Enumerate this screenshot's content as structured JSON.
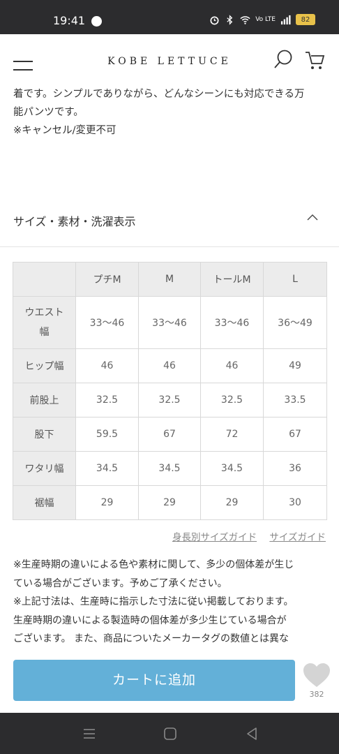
{
  "status_bar": {
    "time": "19:41",
    "battery": "82",
    "volte": "Vo LTE"
  },
  "header": {
    "brand": "KOBE LETTUCE"
  },
  "description": {
    "lines": [
      "着です。シンプルでありながら、どんなシーンにも対応できる万",
      "能パンツです。",
      "※キャンセル/変更不可"
    ]
  },
  "size_section": {
    "title": "サイズ・素材・洗濯表示"
  },
  "size_table": {
    "columns": [
      "",
      "プチM",
      "M",
      "トールM",
      "L"
    ],
    "rows": [
      {
        "label_line1": "ウエスト",
        "label_line2": "幅",
        "values": [
          "33〜46",
          "33〜46",
          "33〜46",
          "36〜49"
        ]
      },
      {
        "label": "ヒップ幅",
        "values": [
          "46",
          "46",
          "46",
          "49"
        ]
      },
      {
        "label": "前股上",
        "values": [
          "32.5",
          "32.5",
          "32.5",
          "33.5"
        ]
      },
      {
        "label": "股下",
        "values": [
          "59.5",
          "67",
          "72",
          "67"
        ]
      },
      {
        "label": "ワタリ幅",
        "values": [
          "34.5",
          "34.5",
          "34.5",
          "36"
        ]
      },
      {
        "label": "裾幅",
        "values": [
          "29",
          "29",
          "29",
          "30"
        ]
      }
    ]
  },
  "guide_links": {
    "height_guide": "身長別サイズガイド",
    "size_guide": "サイズガイド"
  },
  "notes": {
    "lines": [
      "※生産時期の違いによる色や素材に関して、多少の個体差が生じ",
      "ている場合がございます。予めご了承ください。",
      "※上記寸法は、生産時に指示した寸法に従い掲載しております。",
      "生産時期の違いによる製造時の個体差が多少生じている場合が",
      "ございます。 また、商品についたメーカータグの数値とは異な"
    ]
  },
  "actions": {
    "add_to_cart": "カートに追加",
    "favorite_count": "382"
  },
  "colors": {
    "cart_button": "#63b0d8",
    "status_bar": "#2c2c2e",
    "table_header": "#ececec"
  }
}
